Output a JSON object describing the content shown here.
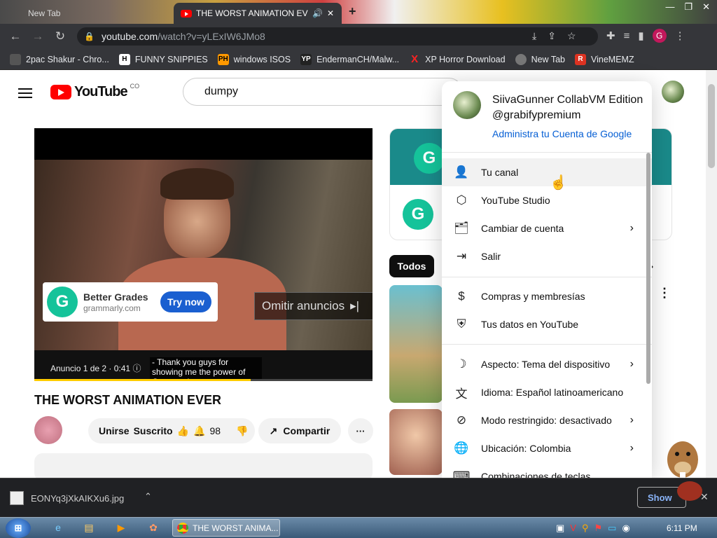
{
  "browser": {
    "tabs": [
      {
        "label": "New Tab"
      },
      {
        "label": "THE WORST ANIMATION EV",
        "active": true
      }
    ],
    "url": "youtube.com",
    "url_path": "/watch?v=yLExIW6JMo8",
    "bookmarks": [
      {
        "label": "2pac Shakur - Chro...",
        "icon": "tupac-icon"
      },
      {
        "label": "FUNNY SNIPPIES",
        "icon": "h-icon"
      },
      {
        "label": "windows ISOS",
        "icon": "ph-icon"
      },
      {
        "label": "EndermanCH/Malw...",
        "icon": "yp-icon"
      },
      {
        "label": "XP Horror Download",
        "icon": "x-icon"
      },
      {
        "label": "New Tab",
        "icon": "globe-icon"
      },
      {
        "label": "VineMEMZ",
        "icon": "r-icon"
      }
    ],
    "profile_initial": "G"
  },
  "youtube": {
    "logo_text": "YouTube",
    "country": "CO",
    "search_value": "dumpy",
    "video": {
      "title": "THE WORST ANIMATION EVER",
      "ad_brand": "Better Grades",
      "ad_domain": "grammarly.com",
      "ad_cta": "Try now",
      "skip_label": "Omitir anuncios",
      "ad_label": "Anuncio 1 de 2 · 0:41",
      "caption": "- Thank you guys for showing me the power of Grammarly.",
      "progress": 0.64
    },
    "actions": {
      "join": "Unirse",
      "subscribed": "Suscrito",
      "like_count": "98",
      "share": "Compartir"
    },
    "filter_chip": "Todos"
  },
  "account_menu": {
    "name": "SiivaGunner CollabVM Edition",
    "handle": "@grabifypremium",
    "manage": "Administra tu Cuenta de Google",
    "items": [
      {
        "label": "Tu canal",
        "icon": "person-icon",
        "chevron": false
      },
      {
        "label": "YouTube Studio",
        "icon": "studio-icon",
        "chevron": false
      },
      {
        "label": "Cambiar de cuenta",
        "icon": "switch-account-icon",
        "chevron": true
      },
      {
        "label": "Salir",
        "icon": "sign-out-icon",
        "chevron": false
      },
      {
        "label": "Compras y membresías",
        "icon": "dollar-icon",
        "chevron": false
      },
      {
        "label": "Tus datos en YouTube",
        "icon": "shield-person-icon",
        "chevron": false
      },
      {
        "label": "Aspecto: Tema del dispositivo",
        "icon": "moon-icon",
        "chevron": true
      },
      {
        "label": "Idioma: Español latinoamericano",
        "icon": "translate-icon",
        "chevron": true
      },
      {
        "label": "Modo restringido: desactivado",
        "icon": "restricted-icon",
        "chevron": true
      },
      {
        "label": "Ubicación: Colombia",
        "icon": "globe-icon",
        "chevron": true
      },
      {
        "label": "Combinaciones de teclas",
        "icon": "keyboard-icon",
        "chevron": false
      }
    ]
  },
  "downloads": {
    "file": "EONYq3jXkAIKXu6.jpg",
    "show_all": "Show"
  },
  "taskbar": {
    "chrome_label": "THE WORST ANIMA...",
    "clock": "6:11 PM"
  }
}
